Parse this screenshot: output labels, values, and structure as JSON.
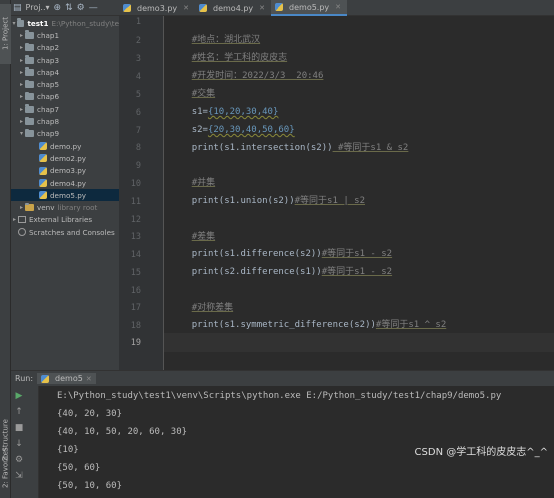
{
  "colors": {
    "background": "#2b2b2b",
    "panel": "#3c3f41",
    "comment": "#808080",
    "number": "#6897bb",
    "identifier": "#a9b7c6",
    "builtin": "#8888c6",
    "selection": "#0d293e"
  },
  "left_strip": {
    "project_tab": "1: Project",
    "structure_tab": "Z: Structure",
    "favorites_tab": "2: Favorites"
  },
  "project_panel": {
    "title": "Proj..▾",
    "tree": {
      "root_name": "test1",
      "root_path": "E:\\Python_study\\te",
      "folders": [
        "chap1",
        "chap2",
        "chap3",
        "chap4",
        "chap5",
        "chap6",
        "chap7",
        "chap8"
      ],
      "open_folder": "chap9",
      "files": [
        "demo.py",
        "demo2.py",
        "demo3.py",
        "demo4.py",
        "demo5.py"
      ],
      "venv_name": "venv",
      "venv_note": "library root",
      "external_libraries": "External Libraries",
      "scratches": "Scratches and Consoles"
    }
  },
  "editor_tabs": [
    {
      "label": "demo3.py",
      "active": false
    },
    {
      "label": "demo4.py",
      "active": false
    },
    {
      "label": "demo5.py",
      "active": true
    }
  ],
  "editor": {
    "line_numbers": [
      "1",
      "2",
      "3",
      "4",
      "5",
      "6",
      "7",
      "8",
      "9",
      "10",
      "11",
      "12",
      "13",
      "14",
      "15",
      "16",
      "17",
      "18",
      "19"
    ],
    "current_line": "19",
    "lines": {
      "l1": "#地点：湖北武汉",
      "l2": "#姓名：学工科的皮皮志",
      "l3": "#开发时间：2022/3/3  20:46",
      "l4": "#交集",
      "l5_a": "s1=",
      "l5_b": "{10,20,30,40}",
      "l6_a": "s2=",
      "l6_b": "{20,30,40,50,60}",
      "l7_code": "print(s1.intersection(s2))",
      "l7_comment": " #等同于s1 & s2",
      "l9": "#并集",
      "l10_code": "print(s1.union(s2))",
      "l10_comment": "#等同于s1 | s2",
      "l12": "#差集",
      "l13_code": "print(s1.difference(s2))",
      "l13_comment": "#等同于s1 - s2",
      "l14_code": "print(s2.difference(s1))",
      "l14_comment": "#等同于s1 - s2",
      "l16": "#对称差集",
      "l17_code": "print(s1.symmetric_difference(s2))",
      "l17_comment": "#等同于s1 ^ s2"
    }
  },
  "run_panel": {
    "label": "Run:",
    "tab": "demo5",
    "output": [
      "E:\\Python_study\\test1\\venv\\Scripts\\python.exe E:/Python_study/test1/chap9/demo5.py",
      "{40, 20, 30}",
      "{40, 10, 50, 20, 60, 30}",
      "{10}",
      "{50, 60}",
      "{50, 10, 60}"
    ]
  },
  "watermark": "CSDN @学工科的皮皮志^_^"
}
